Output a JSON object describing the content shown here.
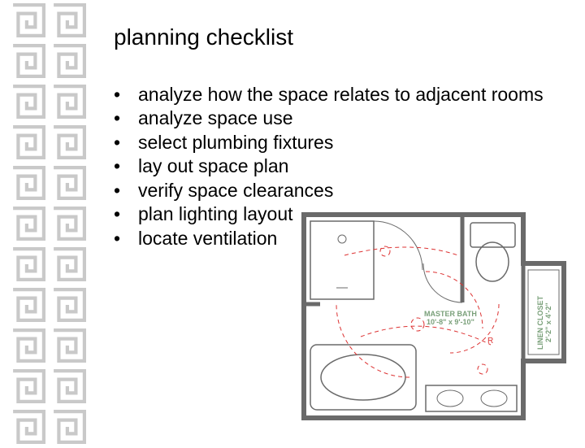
{
  "slide": {
    "title": "planning checklist",
    "bullets": [
      "analyze how the space relates to adjacent rooms",
      "analyze space use",
      "select plumbing fixtures",
      "lay out space plan",
      "verify space clearances",
      "plan lighting layout",
      "locate ventilation"
    ]
  },
  "floorplan": {
    "linen_label": "LINEN CLOSET",
    "linen_dims": "2'-2\" x 4'-2\"",
    "master_label": "MASTER BATH",
    "master_dims": "10'-8\" x 9'-10\"",
    "mark_r": "R"
  }
}
